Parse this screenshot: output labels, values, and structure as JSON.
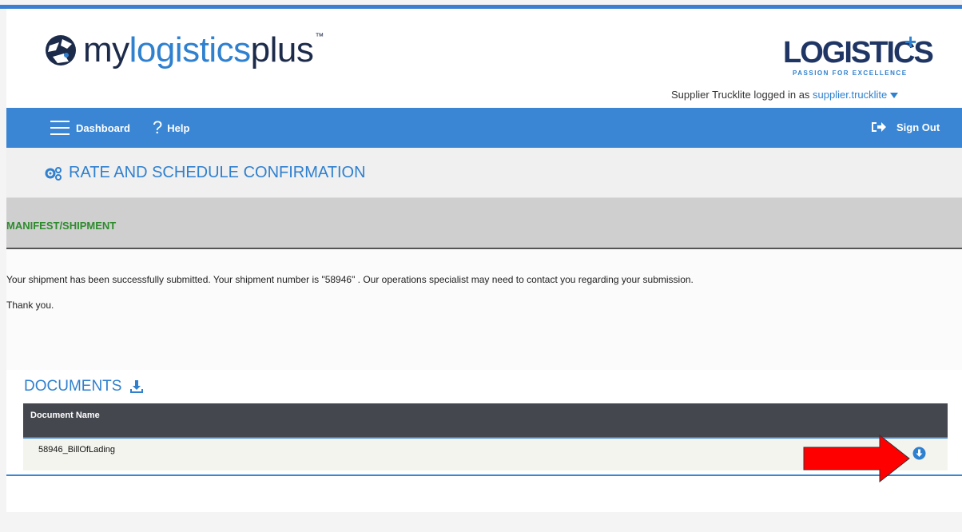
{
  "brand": {
    "app_logo_a": "my",
    "app_logo_b": "logistics",
    "app_logo_c": "plus",
    "app_logo_tm": "™",
    "company_logo_word": "LOGISTICS",
    "company_logo_plus": "+",
    "company_tagline": "PASSION FOR EXCELLENCE"
  },
  "header": {
    "login_prefix": "Supplier Trucklite logged in as ",
    "login_user": "supplier.trucklite"
  },
  "nav": {
    "dashboard_label": "Dashboard",
    "help_icon": "?",
    "help_label": "Help",
    "signout_label": "Sign Out"
  },
  "page": {
    "title": "RATE AND SCHEDULE CONFIRMATION",
    "section_title": "MANIFEST/SHIPMENT",
    "message": "Your shipment has been successfully submitted. Your shipment number is \"58946\" . Our operations specialist may need to contact you regarding your submission.",
    "thanks": "Thank you."
  },
  "documents": {
    "title": "DOCUMENTS",
    "column_header": "Document Name",
    "rows": [
      {
        "name": "58946_BillOfLading"
      }
    ]
  },
  "colors": {
    "accent": "#2f80cf",
    "navbar": "#3a86d4",
    "section_text": "#2e8b2e",
    "table_header": "#45474f",
    "annotation_arrow": "#ff0000"
  },
  "icons": {
    "menu": "hamburger-menu-icon",
    "help": "question-mark-icon",
    "signout": "sign-out-icon",
    "title": "gears-icon",
    "documents": "download-icon",
    "row_download": "circle-arrow-down-icon"
  }
}
